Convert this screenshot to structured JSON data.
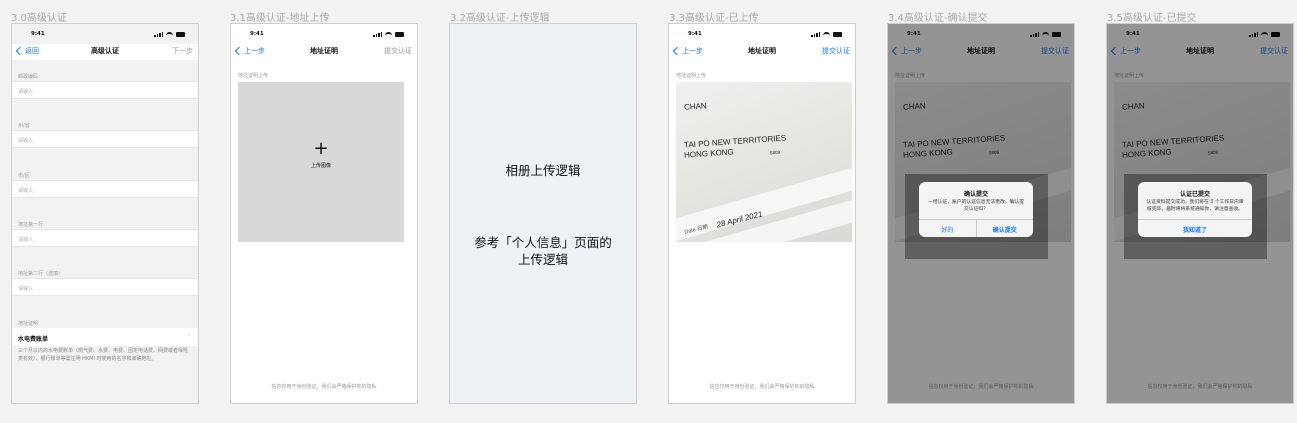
{
  "artboards": [
    {
      "title": "3.0高级认证"
    },
    {
      "title": "3.1高级认证-地址上传"
    },
    {
      "title": "3.2高级认证-上传逻辑"
    },
    {
      "title": "3.3高级认证-已上传"
    },
    {
      "title": "3.4高级认证-确认提交"
    },
    {
      "title": "3.5高级认证-已提交"
    }
  ],
  "status_time": "9:41",
  "screen0": {
    "nav": {
      "back": "返回",
      "title": "高级认证",
      "right": "下一步"
    },
    "fields": [
      {
        "label": "邮政编码",
        "placeholder": "请输入"
      },
      {
        "label": "州/省",
        "placeholder": "请输入"
      },
      {
        "label": "市/区",
        "placeholder": "请输入"
      },
      {
        "label": "地址第一行",
        "placeholder": "请输入"
      },
      {
        "label": "地址第二行（选填）",
        "placeholder": "请输入"
      }
    ],
    "proof": {
      "label": "地址证明",
      "value": "水电费账单",
      "arrow": "›"
    },
    "note": "三个月以内的水电费账单（燃气费、水费、电费、固定电话费、网费或者保险类有效）、银行账单等需注明 HKMI 时使用的名字和准确地址。"
  },
  "screen1": {
    "nav": {
      "back": "上一步",
      "title": "地址证明",
      "right": "提交认证"
    },
    "section_label": "地址证明上传",
    "upload_plus": "+",
    "upload_label": "上传图像",
    "footer": "信息仅用于身份验证，我们会严格保护你的隐私"
  },
  "screen2": {
    "line1": "相册上传逻辑",
    "line2a": "参考「个人信息」页面的",
    "line2b": "上传逻辑"
  },
  "doc": {
    "name": "CHAN",
    "addr1": "TAI PO NEW TERRITORIES",
    "addr2": "HONG KONG",
    "code": "5809",
    "date_label": "Date 日期",
    "date": "28 April 2021"
  },
  "screen3": {
    "nav": {
      "back": "上一步",
      "title": "地址证明",
      "right": "提交认证"
    },
    "section_label": "地址证明上传",
    "footer": "信息仅用于身份验证，我们会严格保护你的隐私"
  },
  "screen4": {
    "nav": {
      "back": "上一步",
      "title": "地址证明",
      "right": "提交认证"
    },
    "section_label": "地址证明上传",
    "alert": {
      "title": "确认提交",
      "message": "一经认证，账户的认证信息无法更改，确认提交认证吗？",
      "cancel": "好的",
      "confirm": "确认提交"
    },
    "footer": "信息仅用于身份验证，我们会严格保护你的隐私"
  },
  "screen5": {
    "nav": {
      "back": "上一步",
      "title": "地址证明",
      "right": "提交认证"
    },
    "section_label": "地址证明上传",
    "alert": {
      "title": "认证已提交",
      "message": "认证资料提交成功，我们将在 3 个工作日内审核完毕，届时将将系统通知你，请注意查收。",
      "ok": "我知道了"
    },
    "footer": "信息仅用于身份验证，我们会严格保护你的隐私"
  },
  "colors": {
    "accent": "#1677ff",
    "canvas": "#f3f3f3"
  }
}
